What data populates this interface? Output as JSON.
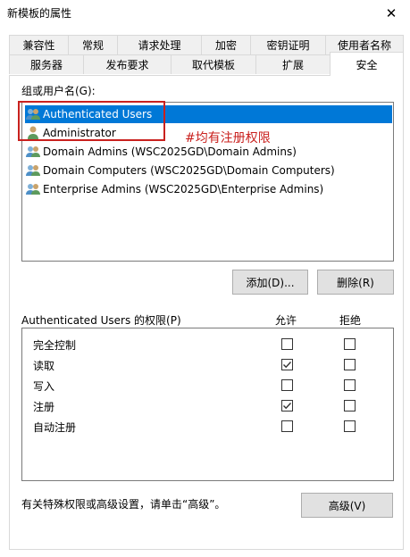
{
  "window": {
    "title": "新模板的属性",
    "close_symbol": "✕"
  },
  "tabs_row1": [
    {
      "label": "兼容性"
    },
    {
      "label": "常规"
    },
    {
      "label": "请求处理"
    },
    {
      "label": "加密"
    },
    {
      "label": "密钥证明"
    },
    {
      "label": "使用者名称"
    }
  ],
  "tabs_row2": [
    {
      "label": "服务器"
    },
    {
      "label": "发布要求"
    },
    {
      "label": "取代模板"
    },
    {
      "label": "扩展"
    },
    {
      "label": "安全",
      "active": true
    }
  ],
  "security": {
    "group_label": "组或用户名(G):",
    "users": [
      {
        "name": "Authenticated Users",
        "icon": "group-icon",
        "selected": true
      },
      {
        "name": "Administrator",
        "icon": "user-icon",
        "selected": false
      },
      {
        "name": "Domain Admins (WSC2025GD\\Domain Admins)",
        "icon": "group-icon",
        "selected": false
      },
      {
        "name": "Domain Computers (WSC2025GD\\Domain Computers)",
        "icon": "group-icon",
        "selected": false
      },
      {
        "name": "Enterprise Admins (WSC2025GD\\Enterprise Admins)",
        "icon": "group-icon",
        "selected": false
      }
    ],
    "annotation": "#均有注册权限",
    "add_button": "添加(D)...",
    "remove_button": "删除(R)",
    "perm_header": "Authenticated Users 的权限(P)",
    "allow_header": "允许",
    "deny_header": "拒绝",
    "permissions": [
      {
        "name": "完全控制",
        "allow": false,
        "deny": false
      },
      {
        "name": "读取",
        "allow": true,
        "deny": false
      },
      {
        "name": "写入",
        "allow": false,
        "deny": false
      },
      {
        "name": "注册",
        "allow": true,
        "deny": false
      },
      {
        "name": "自动注册",
        "allow": false,
        "deny": false
      }
    ],
    "advanced_text": "有关特殊权限或高级设置，请单击“高级”。",
    "advanced_button": "高级(V)"
  },
  "colors": {
    "selection": "#0078d7",
    "annotation": "#c9211e"
  }
}
